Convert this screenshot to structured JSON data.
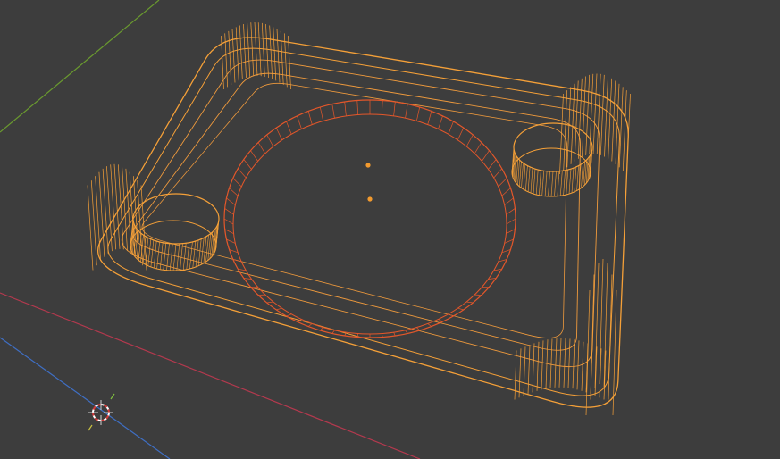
{
  "viewport": {
    "mode": "3D Viewport",
    "view": "perspective",
    "shading": "wireframe",
    "background_color": "#3d3d3d"
  },
  "colors": {
    "axis_x": "#b4394e",
    "axis_y": "#6a9a2f",
    "axis_z": "#3f6fc4",
    "selected_active": "#f5a038",
    "selected_inner": "#ef9a3d",
    "selected_other": "#e5572a",
    "origin_dot": "#f29a2e"
  },
  "scene": {
    "objects": [
      {
        "name": "tray-body",
        "type": "mesh",
        "state": "active-selected"
      },
      {
        "name": "center-ring",
        "type": "mesh",
        "state": "selected"
      },
      {
        "name": "left-cup-holder",
        "type": "mesh",
        "state": "active-selected"
      },
      {
        "name": "right-cup-holder",
        "type": "mesh",
        "state": "active-selected"
      }
    ],
    "origins": 2,
    "cursor": "3d-cursor"
  }
}
